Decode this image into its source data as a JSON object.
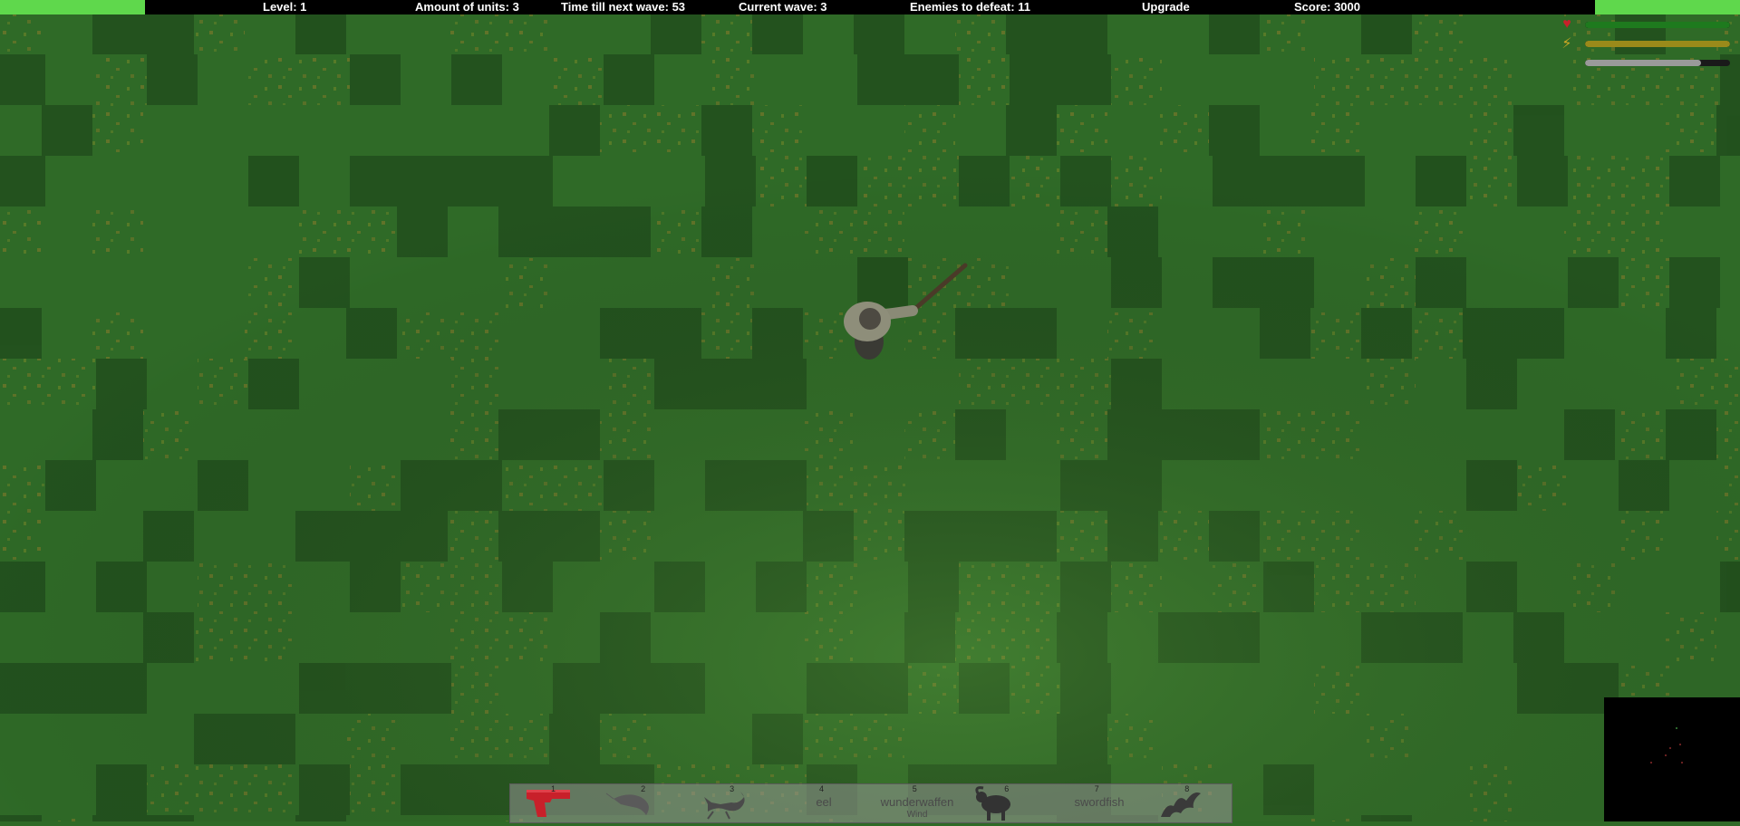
{
  "hud": {
    "level": "Level: 1",
    "units": "Amount of units: 3",
    "time": "Time till next wave: 53",
    "wave": "Current wave: 3",
    "enemies": "Enemies to defeat: 11",
    "upgrade": "Upgrade",
    "score": "Score: 3000"
  },
  "status_bars": {
    "health": {
      "icon": "heart-icon",
      "color": "#1e7a1e",
      "level": 1.0
    },
    "energy": {
      "icon": "lightning-icon",
      "color": "#9a8a1a",
      "level": 1.0
    },
    "stamina": {
      "icon": "none",
      "color": "#9a9a9a",
      "level": 0.8
    }
  },
  "weapons": [
    {
      "num": "1",
      "label": "",
      "sub": "",
      "icon": "pistol-icon",
      "selected": true
    },
    {
      "num": "2",
      "label": "",
      "sub": "",
      "icon": "shrimp-icon",
      "selected": false
    },
    {
      "num": "3",
      "label": "",
      "sub": "",
      "icon": "scorpion-icon",
      "selected": false
    },
    {
      "num": "4",
      "label": "eel",
      "sub": "",
      "icon": "",
      "selected": false
    },
    {
      "num": "5",
      "label": "wunderwaffen",
      "sub": "Wind",
      "icon": "",
      "selected": false
    },
    {
      "num": "6",
      "label": "",
      "sub": "",
      "icon": "ram-icon",
      "selected": false
    },
    {
      "num": "7",
      "label": "swordfish",
      "sub": "",
      "icon": "",
      "selected": false
    },
    {
      "num": "8",
      "label": "",
      "sub": "",
      "icon": "bat-icon",
      "selected": false
    }
  ],
  "colors": {
    "grass": "#2f6a27",
    "grass_dark": "#1f3f1c",
    "accent_red": "#c8202a",
    "hud_green": "#5fd84c"
  }
}
